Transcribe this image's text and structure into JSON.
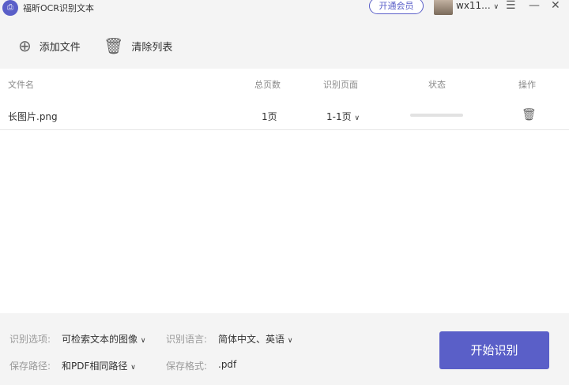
{
  "app": {
    "title": "福昕OCR识别文本",
    "vip_label": "开通会员",
    "username": "wx11...",
    "logo_text": "OCR"
  },
  "toolbar": {
    "add_file": "添加文件",
    "clear_list": "清除列表"
  },
  "table": {
    "headers": [
      "文件名",
      "总页数",
      "识别页面",
      "状态",
      "操作"
    ],
    "rows": [
      {
        "name": "长图片.png",
        "pages": "1页",
        "range": "1-1页",
        "progress": 0
      }
    ]
  },
  "options": {
    "option_label": "识别选项:",
    "option_value": "可检索文本的图像",
    "lang_label": "识别语言:",
    "lang_value": "简体中文、英语",
    "path_label": "保存路径:",
    "path_value": "和PDF相同路径",
    "format_label": "保存格式:",
    "format_value": ".pdf"
  },
  "start_button": "开始识别"
}
